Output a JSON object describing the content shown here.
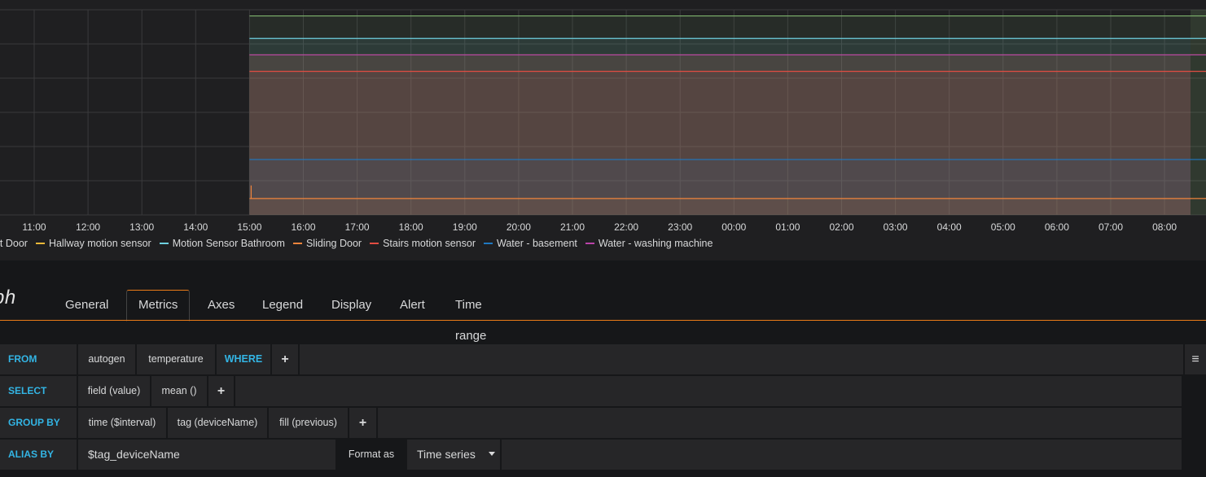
{
  "chart_data": {
    "type": "line",
    "x_ticks": [
      "11:00",
      "12:00",
      "13:00",
      "14:00",
      "15:00",
      "16:00",
      "17:00",
      "18:00",
      "19:00",
      "20:00",
      "21:00",
      "22:00",
      "23:00",
      "00:00",
      "01:00",
      "02:00",
      "03:00",
      "04:00",
      "05:00",
      "06:00",
      "07:00",
      "08:00"
    ],
    "data_start": "15:00",
    "series": [
      {
        "name": "ont Door",
        "color": "#7eb26d",
        "level": 0.97
      },
      {
        "name": "Hallway motion sensor",
        "color": "#eab839",
        "level": 0.78
      },
      {
        "name": "Motion Sensor Bathroom",
        "color": "#6ed0e0",
        "level": 0.86
      },
      {
        "name": "Sliding Door",
        "color": "#ef843c",
        "level": 0.08
      },
      {
        "name": "Stairs motion sensor",
        "color": "#e24d42",
        "level": 0.7
      },
      {
        "name": "Water - basement",
        "color": "#1f78c1",
        "level": 0.27
      },
      {
        "name": "Water - washing machine",
        "color": "#ba43a9",
        "level": 0.78
      }
    ],
    "grid": true
  },
  "panel": {
    "title": "ph"
  },
  "tabs": [
    {
      "label": "General",
      "active": false
    },
    {
      "label": "Metrics",
      "active": true
    },
    {
      "label": "Axes",
      "active": false
    },
    {
      "label": "Legend",
      "active": false
    },
    {
      "label": "Display",
      "active": false
    },
    {
      "label": "Alert",
      "active": false
    },
    {
      "label": "Time range",
      "active": false
    }
  ],
  "query": {
    "from": {
      "keyword": "FROM",
      "retention": "autogen",
      "measurement": "temperature",
      "where": "WHERE",
      "add": "+"
    },
    "select": {
      "keyword": "SELECT",
      "field": "field (value)",
      "fn": "mean ()",
      "add": "+"
    },
    "group_by": {
      "keyword": "GROUP BY",
      "time": "time ($interval)",
      "tag": "tag (deviceName)",
      "fill": "fill (previous)",
      "add": "+"
    },
    "alias_by": {
      "keyword": "ALIAS BY",
      "value": "$tag_deviceName",
      "format_label": "Format as",
      "format_value": "Time series"
    },
    "menu_icon": "hamburger-icon"
  }
}
